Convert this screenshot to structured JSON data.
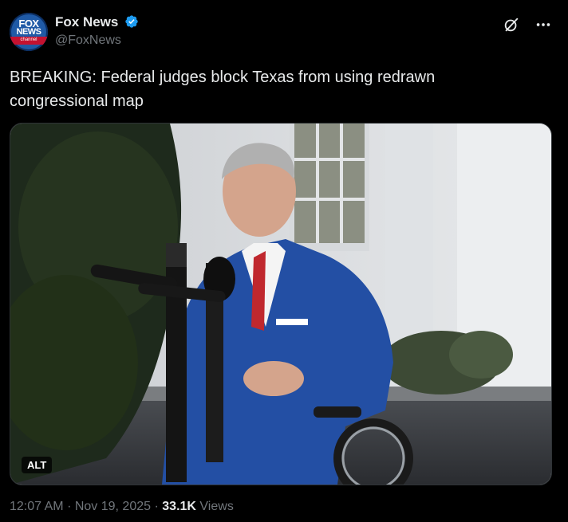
{
  "author": {
    "display_name": "Fox News",
    "handle": "@FoxNews",
    "avatar_text_top": "FOX",
    "avatar_text_bottom": "NEWS",
    "avatar_text_small": "channel",
    "verified": true
  },
  "tweet": {
    "text": "BREAKING: Federal judges block Texas from using redrawn congressional map"
  },
  "media": {
    "alt_label": "ALT"
  },
  "meta": {
    "time": "12:07 AM",
    "separator": "·",
    "date": "Nov 19, 2025",
    "views_count": "33.1K",
    "views_label": "Views"
  },
  "icons": {
    "grok": "grok-icon",
    "more": "more-icon",
    "verified": "verified-badge-icon"
  },
  "colors": {
    "background": "#000000",
    "text": "#e7e9ea",
    "muted": "#71767b",
    "verified": "#1d9bf0"
  }
}
